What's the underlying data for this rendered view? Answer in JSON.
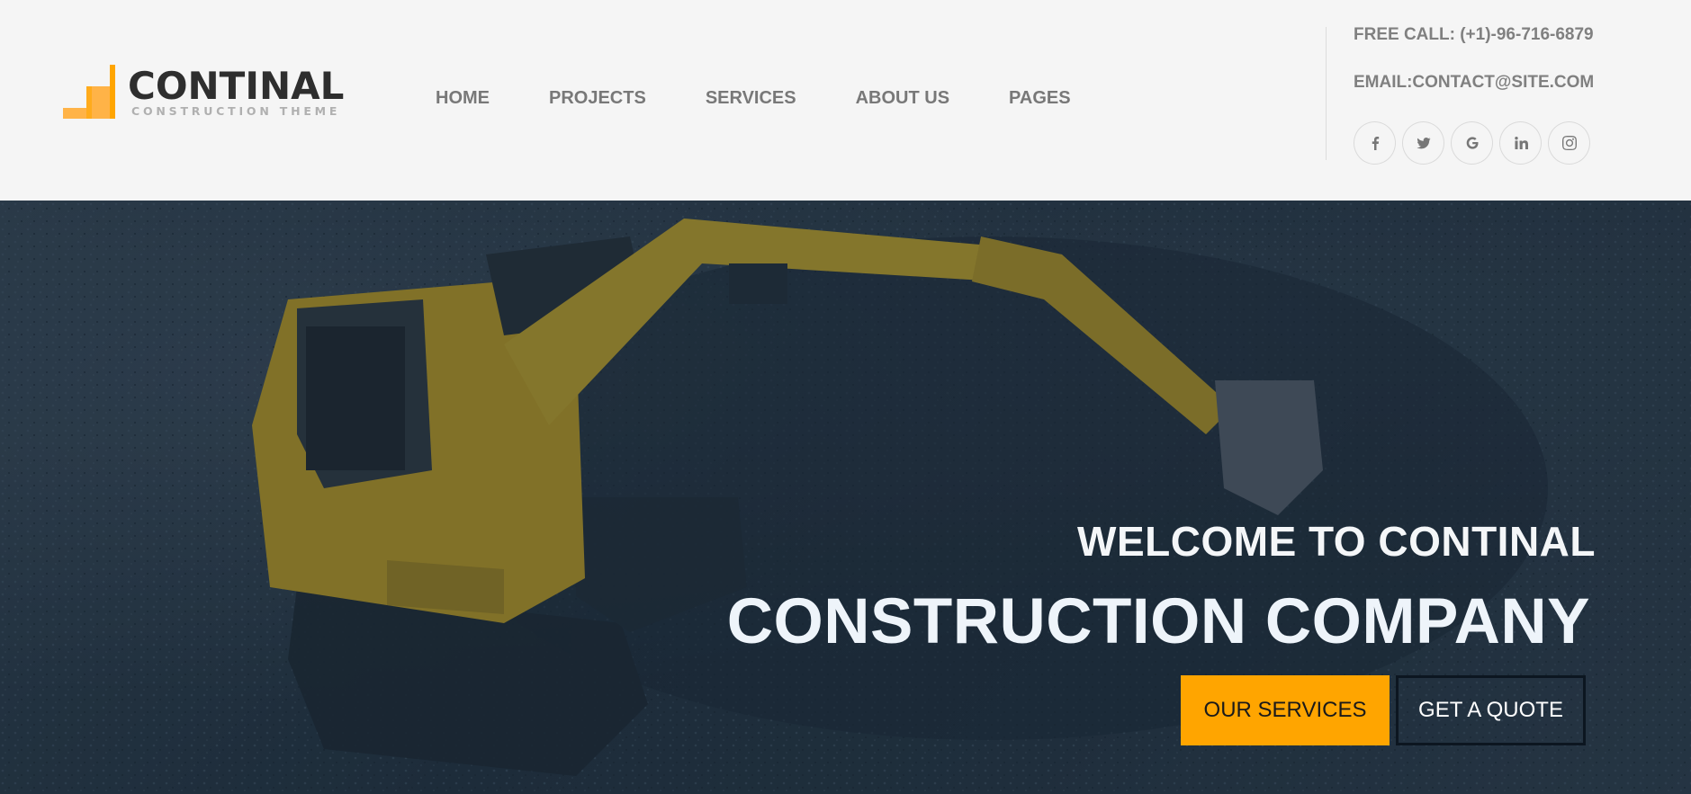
{
  "brand": {
    "name": "CONTINAL",
    "tagline": "CONSTRUCTION THEME",
    "accent_color": "#ffa500",
    "logo_icon": "stairs-block-icon"
  },
  "nav": {
    "items": [
      {
        "label": "HOME"
      },
      {
        "label": "PROJECTS"
      },
      {
        "label": "SERVICES"
      },
      {
        "label": "ABOUT US"
      },
      {
        "label": "PAGES"
      }
    ]
  },
  "contact": {
    "phone": "FREE CALL: (+1)-96-716-6879",
    "email": "EMAIL:CONTACT@SITE.COM"
  },
  "social": [
    {
      "icon": "facebook-icon",
      "glyph": "f"
    },
    {
      "icon": "twitter-icon",
      "glyph": ""
    },
    {
      "icon": "google-icon",
      "glyph": "G"
    },
    {
      "icon": "linkedin-icon",
      "glyph": "in"
    },
    {
      "icon": "instagram-icon",
      "glyph": ""
    }
  ],
  "hero": {
    "welcome": "WELCOME TO CONTINAL",
    "headline": "CONSTRUCTION COMPANY",
    "primary_button": "OUR SERVICES",
    "secondary_button": "GET A QUOTE",
    "background_image": "excavator-photo"
  }
}
